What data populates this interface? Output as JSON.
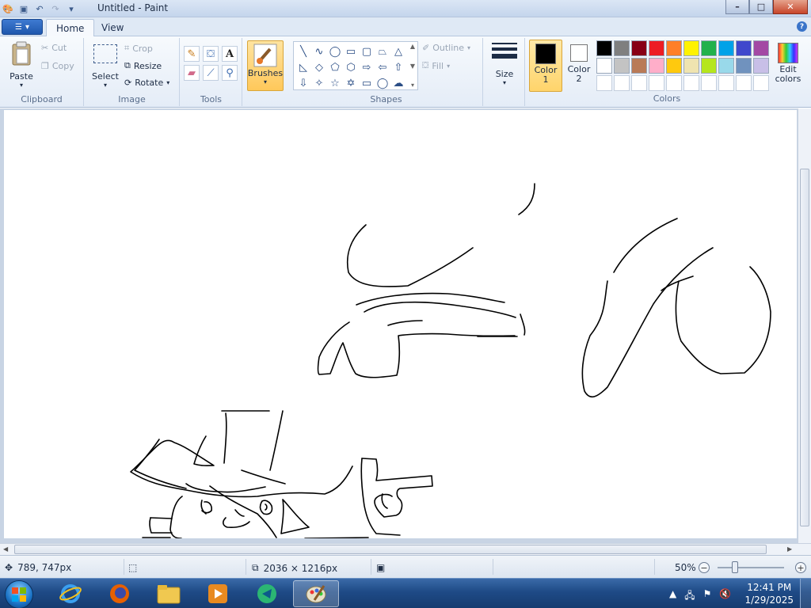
{
  "window": {
    "title": "Untitled - Paint",
    "controls": {
      "minimize": "–",
      "maximize": "□",
      "close": "✕"
    }
  },
  "tabs": [
    {
      "label": "Home"
    },
    {
      "label": "View"
    }
  ],
  "ribbon": {
    "clipboard": {
      "label": "Clipboard",
      "paste": "Paste",
      "cut": "Cut",
      "copy": "Copy"
    },
    "image": {
      "label": "Image",
      "select": "Select",
      "crop": "Crop",
      "resize": "Resize",
      "rotate": "Rotate"
    },
    "tools": {
      "label": "Tools"
    },
    "brushes": {
      "label": "Brushes"
    },
    "shapes": {
      "label": "Shapes",
      "outline": "Outline",
      "fill": "Fill"
    },
    "size": {
      "label": "Size"
    },
    "colors": {
      "label": "Colors",
      "color1": {
        "line1": "Color",
        "line2": "1",
        "value": "#000000"
      },
      "color2": {
        "line1": "Color",
        "line2": "2",
        "value": "#ffffff"
      },
      "edit": {
        "line1": "Edit",
        "line2": "colors"
      },
      "palette": [
        "#000000",
        "#7f7f7f",
        "#880015",
        "#ed1c24",
        "#ff7f27",
        "#fff200",
        "#22b14c",
        "#00a2e8",
        "#3f48cc",
        "#a349a4",
        "#ffffff",
        "#c3c3c3",
        "#b97a57",
        "#ffaec9",
        "#ffc90e",
        "#efe4b0",
        "#b5e61d",
        "#99d9ea",
        "#7092be",
        "#c8bfe7",
        "#ffffff",
        "#ffffff",
        "#ffffff",
        "#ffffff",
        "#ffffff",
        "#ffffff",
        "#ffffff",
        "#ffffff",
        "#ffffff",
        "#ffffff"
      ]
    }
  },
  "statusbar": {
    "cursor": "789, 747px",
    "selection": "",
    "image_size": "2036 × 1216px",
    "zoom": "50%"
  },
  "taskbar": {
    "apps": [
      "internet-explorer",
      "firefox",
      "file-explorer",
      "media-player",
      "app-green",
      "paint"
    ],
    "time": "12:41 PM",
    "date": "1/29/2025"
  }
}
